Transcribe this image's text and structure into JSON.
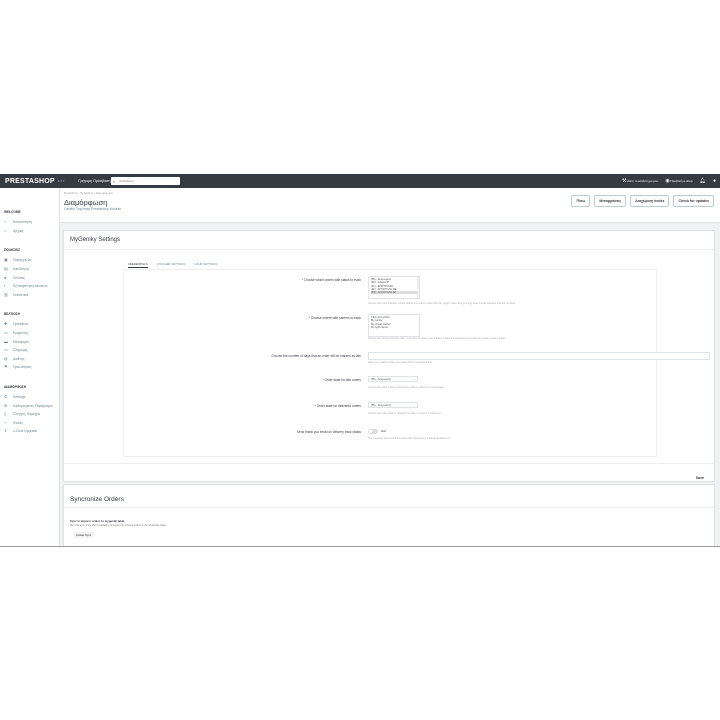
{
  "topbar": {
    "logo": "PRESTASHOP",
    "version": "1.7.7",
    "quick_access": "Γρήγορη Πρόσβαση ▾",
    "search_placeholder": "Αναζήτηση",
    "store_link": "Δείτε το κατάστημα μου",
    "view_shop": "Προβολή e-shop"
  },
  "sidebar": {
    "sections": [
      {
        "title": "WELCOME",
        "items": [
          {
            "icon": "chart-line-icon",
            "label": "Επισκόπηση"
          },
          {
            "icon": "home-icon",
            "label": "Αρχική"
          }
        ]
      },
      {
        "title": "ΠΩΛΗΣΕΙΣ",
        "items": [
          {
            "icon": "inbox-icon",
            "label": "Παραγγελίες"
          },
          {
            "icon": "store-icon",
            "label": "Κατάλογος"
          },
          {
            "icon": "user-icon",
            "label": "Πελάτες"
          },
          {
            "icon": "chat-icon",
            "label": "Εξυπηρέτηση πελατών"
          },
          {
            "icon": "stats-icon",
            "label": "Στατιστικά"
          }
        ]
      },
      {
        "title": "ΒΕΛΤΙΩΣΗ",
        "items": [
          {
            "icon": "puzzle-icon",
            "label": "Πρόσθετα"
          },
          {
            "icon": "desktop-icon",
            "label": "Εμφάνιση"
          },
          {
            "icon": "truck-icon",
            "label": "Μεταφορά"
          },
          {
            "icon": "card-icon",
            "label": "Πληρωμή"
          },
          {
            "icon": "globe-icon",
            "label": "Διεθνής"
          },
          {
            "icon": "flag-icon",
            "label": "Προωθήσεις"
          }
        ]
      },
      {
        "title": "ΔΙΑΜΟΡΦΩΣΗ",
        "items": [
          {
            "icon": "gear-icon",
            "label": "Settings"
          },
          {
            "icon": "gear-icon",
            "label": "Καθορισμένες Παράμετροι"
          },
          {
            "icon": "phone-icon",
            "label": "Έλεγχος Παρόχου"
          },
          {
            "icon": "trend-icon",
            "label": "Φαλάς"
          },
          {
            "icon": "upgrade-icon",
            "label": "1-Click Upgrade"
          }
        ]
      }
    ]
  },
  "header": {
    "breadcrumb": "Πρόσθετα › Πρόσθετα › Διαμόρφωση",
    "title": "Διαμόρφωση",
    "subtitle": "Geniky Ταχύτητα Prestashop Module",
    "buttons": [
      "Πίσω",
      "Μεταφράσεις",
      "Διαχείριση hooks",
      "Check for updates"
    ]
  },
  "settings": {
    "title": "MyGeniky Settings",
    "tabs": [
      "CREDENTIALS",
      "VOUCHER SETTINGS",
      "COUR SETTINGS"
    ],
    "status_label": "* Choose which orders with status to track",
    "status_options": [
      "(85) - Ακυρωμένη",
      "(90) - ΞΑΝΑ ΠΡ",
      "(91) - ΕΠΙΣΤΡΟΦΗ",
      "(92) - ΑΠΟΣΤΟΛΗ ΜΕ",
      "(94) - ΑΠΟΣΤΟΛΗ ΑΠ"
    ],
    "status_help": "Choose the order statuses whose orders you want to track with the plugin. Make sure you only select order statuses that are not final.",
    "carrier_label": "* Choose orders with carriers to track",
    "carrier_options": [
      "Click and collect",
      "My carrier",
      "My cheap carrier",
      "My light carrier"
    ],
    "carrier_help": "Choose the carriers that the order must have in order to be tracked. Leave it unselected if you want all carriers to be tracked.",
    "days_label": "Choose the number of days that an order will be marked as late",
    "days_help": "After this number of days the order will be considered late.",
    "late_label": "* Order state for late orders",
    "late_value": "(85) - Ακυρωμένη",
    "late_help": "Choose the order state to change the order to when it is marked late.",
    "delivered_label": "* Order state for delivered orders",
    "delivered_value": "(85) - Ακυρωμένη",
    "delivered_help": "Choose the order state to change the order to when it is delivered.",
    "email_label": "Send thank you email on delivery track status",
    "email_value": "ΝΑΙ",
    "email_help": "The customer will receive an email when the order is marked as delivered.",
    "save": "Save"
  },
  "sync": {
    "title": "Syncronize Orders",
    "heading": "Sync to import / orders to mygeniki table.",
    "text": "Run this sync once after installation to import the existing orders to the MyGeniky table.",
    "button": "Initiate Sync"
  }
}
